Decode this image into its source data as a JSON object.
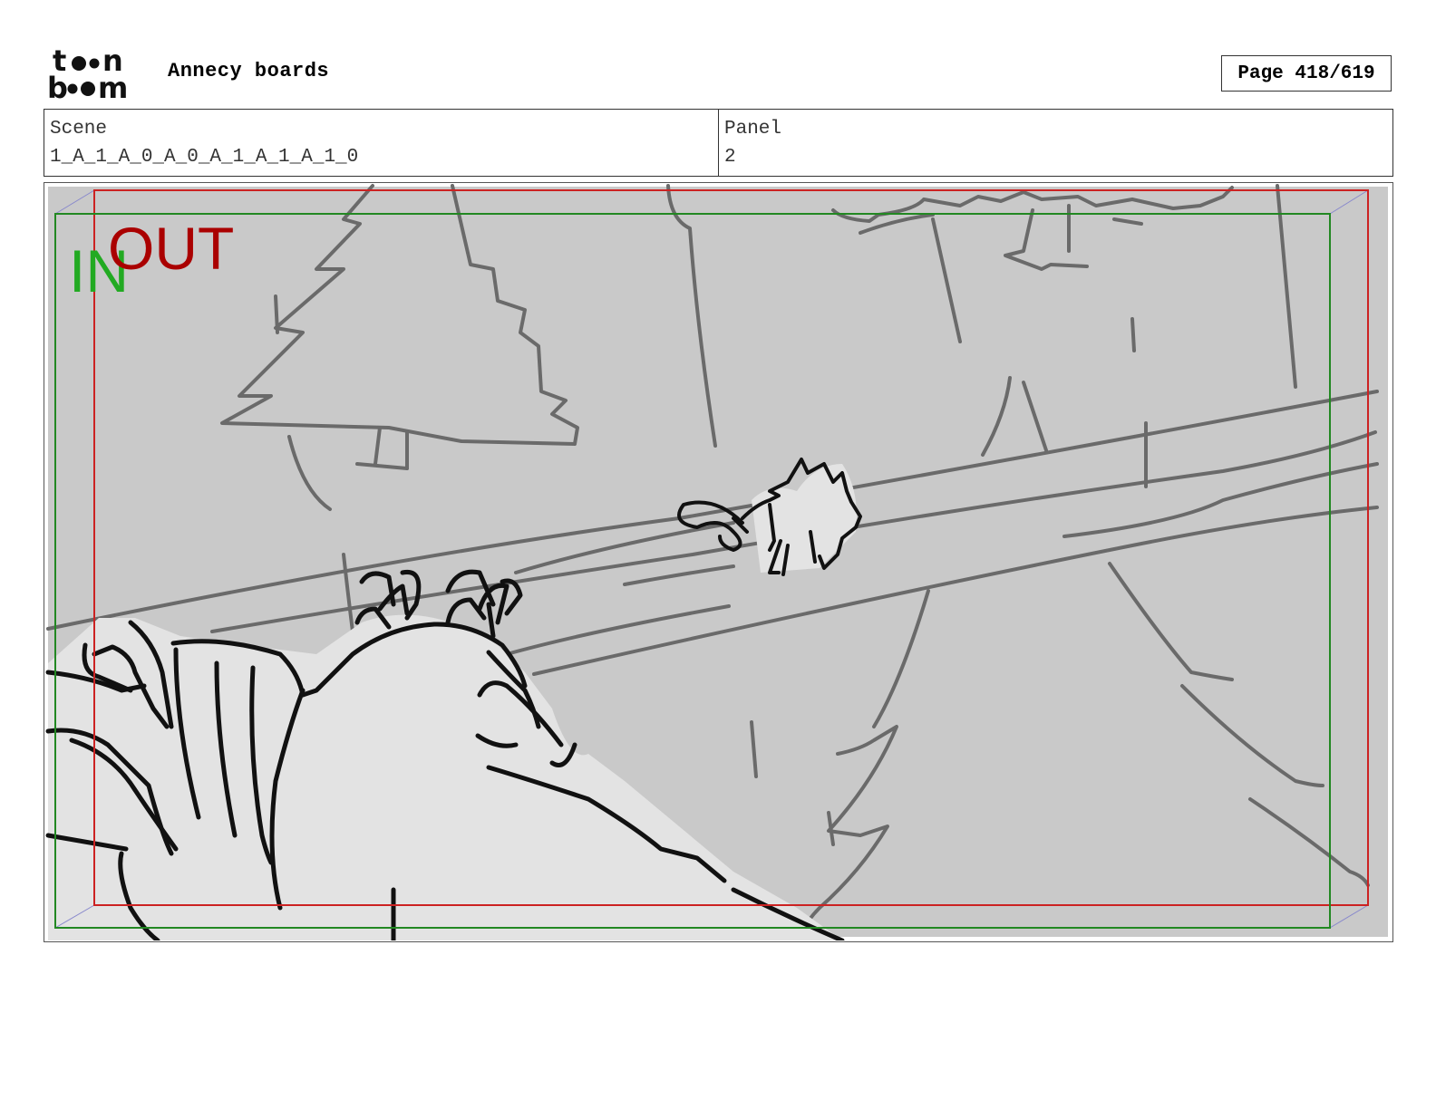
{
  "header": {
    "logo_text": "toon boom",
    "project_title": "Annecy boards",
    "page_label": "Page 418/619"
  },
  "info": {
    "scene_label": "Scene",
    "scene_value": "1_A_1_A_0_A_0_A_1_A_1_A_1_0",
    "panel_label": "Panel",
    "panel_value": "2"
  },
  "panel": {
    "in_label": "IN",
    "out_label": "OUT",
    "in_color": "#22aa22",
    "out_color": "#aa0000",
    "background_color": "#c9c9c9"
  }
}
